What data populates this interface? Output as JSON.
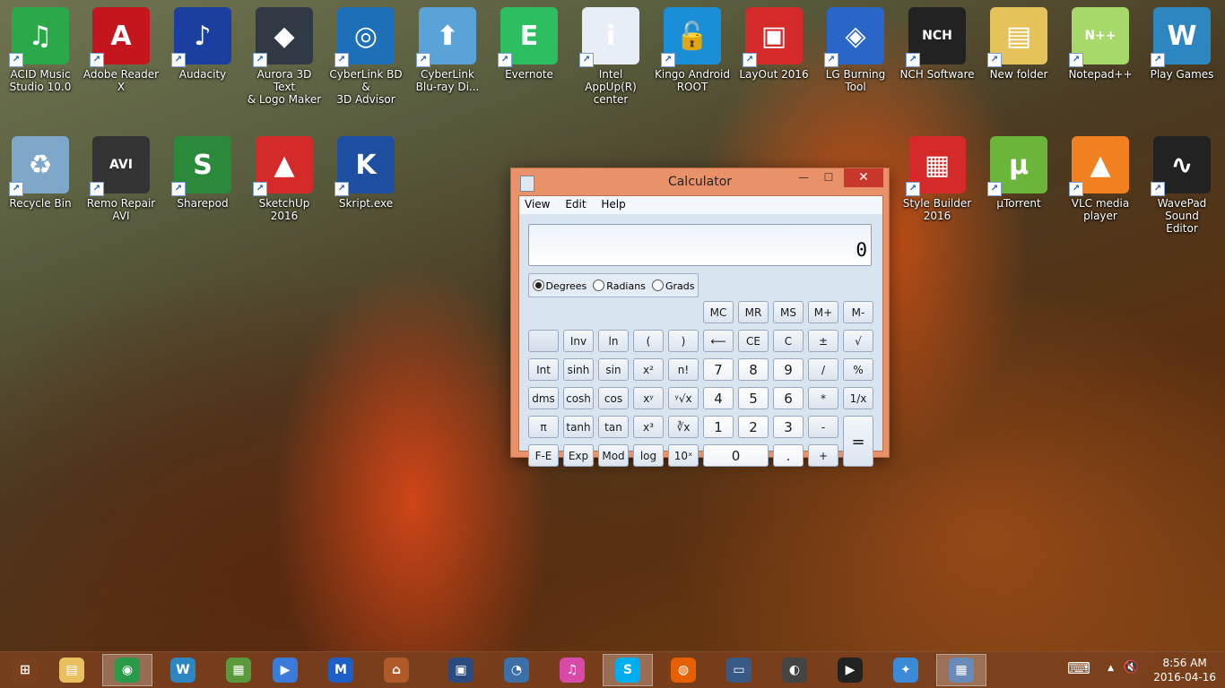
{
  "desktop": {
    "icons": [
      {
        "label": "ACID Music\nStudio 10.0",
        "icon": "music-note-icon",
        "color": "#2ba84a",
        "glyph": "♫"
      },
      {
        "label": "Adobe Reader X",
        "icon": "adobe-reader-icon",
        "color": "#c4161c",
        "glyph": "A"
      },
      {
        "label": "Audacity",
        "icon": "audacity-icon",
        "color": "#1a3f9e",
        "glyph": "♪"
      },
      {
        "label": "Aurora 3D Text\n& Logo Maker",
        "icon": "aurora-3d-icon",
        "color": "#2f3a44",
        "glyph": "◆"
      },
      {
        "label": "CyberLink BD &\n3D Advisor",
        "icon": "cyberlink-advisor-icon",
        "color": "#1d6fb8",
        "glyph": "◎"
      },
      {
        "label": "CyberLink\nBlu-ray Di...",
        "icon": "cyberlink-bluray-icon",
        "color": "#5aa3d8",
        "glyph": "⬆"
      },
      {
        "label": "Evernote",
        "icon": "evernote-icon",
        "color": "#2dbe60",
        "glyph": "E"
      },
      {
        "label": "Intel AppUp(R)\ncenter",
        "icon": "intel-appup-icon",
        "color": "#e8eef5",
        "glyph": "i"
      },
      {
        "label": "Kingo Android\nROOT",
        "icon": "kingo-root-icon",
        "color": "#1a8fd8",
        "glyph": "🔓"
      },
      {
        "label": "LayOut 2016",
        "icon": "layout-icon",
        "color": "#d42a2a",
        "glyph": "▣"
      },
      {
        "label": "LG Burning Tool",
        "icon": "lg-burning-icon",
        "color": "#2a66c8",
        "glyph": "◈"
      },
      {
        "label": "NCH Software",
        "icon": "nch-software-icon",
        "color": "#222222",
        "glyph": "NCH"
      },
      {
        "label": "New folder",
        "icon": "folder-icon",
        "color": "#e6c35a",
        "glyph": "▤"
      },
      {
        "label": "Notepad++",
        "icon": "notepad-plus-plus-icon",
        "color": "#a6d86a",
        "glyph": "N++"
      },
      {
        "label": "Play Games",
        "icon": "play-games-icon",
        "color": "#2e86c1",
        "glyph": "W"
      },
      {
        "label": "Recycle Bin",
        "icon": "recycle-bin-icon",
        "color": "#7fa7c9",
        "glyph": "♻"
      },
      {
        "label": "Remo Repair\nAVI",
        "icon": "remo-repair-icon",
        "color": "#333333",
        "glyph": "AVI"
      },
      {
        "label": "Sharepod",
        "icon": "sharepod-icon",
        "color": "#2a8a3a",
        "glyph": "S"
      },
      {
        "label": "SketchUp 2016",
        "icon": "sketchup-icon",
        "color": "#d42a2a",
        "glyph": "▲"
      },
      {
        "label": "Skript.exe",
        "icon": "skript-icon",
        "color": "#1e4fa0",
        "glyph": "K"
      },
      {
        "label": "Style Builder\n2016",
        "icon": "style-builder-icon",
        "color": "#d42a2a",
        "glyph": "▦"
      },
      {
        "label": "µTorrent",
        "icon": "utorrent-icon",
        "color": "#6ab53a",
        "glyph": "µ"
      },
      {
        "label": "VLC media\nplayer",
        "icon": "vlc-icon",
        "color": "#f08020",
        "glyph": "▲"
      },
      {
        "label": "WavePad Sound\nEditor",
        "icon": "wavepad-icon",
        "color": "#222222",
        "glyph": "∿"
      }
    ]
  },
  "calculator": {
    "title": "Calculator",
    "minimize": "—",
    "maximize": "☐",
    "close": "✕",
    "menu": {
      "view": "View",
      "edit": "Edit",
      "help": "Help"
    },
    "display": "0",
    "angle": {
      "degrees": "Degrees",
      "radians": "Radians",
      "grads": "Grads",
      "selected": "Degrees"
    },
    "keys": [
      "MC",
      "MR",
      "MS",
      "M+",
      "M-",
      "",
      "Inv",
      "ln",
      "(",
      ")",
      "⟵",
      "CE",
      "C",
      "±",
      "√",
      "Int",
      "sinh",
      "sin",
      "x²",
      "n!",
      "7",
      "8",
      "9",
      "/",
      "%",
      "dms",
      "cosh",
      "cos",
      "xʸ",
      "ʸ√x",
      "4",
      "5",
      "6",
      "*",
      "1/x",
      "π",
      "tanh",
      "tan",
      "x³",
      "∛x",
      "1",
      "2",
      "3",
      "-",
      "=",
      "F-E",
      "Exp",
      "Mod",
      "log",
      "10ˣ",
      "0",
      ".",
      "+"
    ]
  },
  "taskbar": {
    "items": [
      {
        "icon": "windows-start-icon",
        "glyph": "⊞",
        "color": "#7a401e"
      },
      {
        "icon": "file-explorer-icon",
        "glyph": "▤",
        "color": "#e8c060"
      },
      {
        "icon": "chrome-icon",
        "glyph": "◉",
        "color": "#2b9a48",
        "active": true
      },
      {
        "icon": "play-games-icon",
        "glyph": "W",
        "color": "#2e86c1"
      },
      {
        "icon": "app-store-icon",
        "glyph": "▦",
        "color": "#5a9a3a"
      },
      {
        "icon": "media-player-icon",
        "glyph": "▶",
        "color": "#3a7ad8"
      },
      {
        "icon": "malwarebytes-icon",
        "glyph": "M",
        "color": "#1d5fc4"
      },
      {
        "icon": "library-icon",
        "glyph": "⌂",
        "color": "#b05a2a"
      },
      {
        "icon": "video-icon",
        "glyph": "▣",
        "color": "#2a4a80"
      },
      {
        "icon": "qq-icon",
        "glyph": "◔",
        "color": "#3a6fa8"
      },
      {
        "icon": "itunes-icon",
        "glyph": "♫",
        "color": "#d84aa8"
      },
      {
        "icon": "skype-icon",
        "glyph": "S",
        "color": "#00aff0",
        "active": true
      },
      {
        "icon": "firefox-icon",
        "glyph": "◍",
        "color": "#e66000"
      },
      {
        "icon": "remote-desktop-icon",
        "glyph": "▭",
        "color": "#3a5a88"
      },
      {
        "icon": "webcam-icon",
        "glyph": "◐",
        "color": "#444444"
      },
      {
        "icon": "media-circle-icon",
        "glyph": "▶",
        "color": "#222222"
      },
      {
        "icon": "safari-icon",
        "glyph": "✦",
        "color": "#3a8ad8"
      },
      {
        "icon": "calculator-icon",
        "glyph": "▦",
        "color": "#6a8ab8",
        "active": true
      }
    ],
    "tray": {
      "keyboard": "⌨",
      "chevron": "▲",
      "volume": "🔇"
    },
    "clock": {
      "time": "8:56 AM",
      "date": "2016-04-16"
    }
  }
}
